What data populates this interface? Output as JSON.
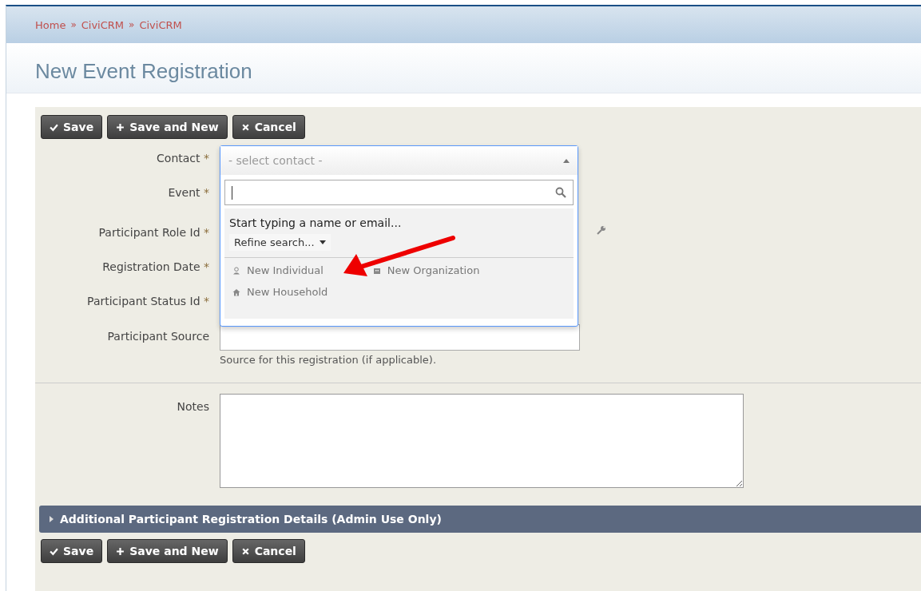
{
  "breadcrumb": [
    "Home",
    "CiviCRM",
    "CiviCRM"
  ],
  "breadcrumb_separator": "»",
  "title": "New Event Registration",
  "buttons": [
    {
      "kind": "save",
      "label": "Save"
    },
    {
      "kind": "new",
      "label": "Save and New"
    },
    {
      "kind": "cancel",
      "label": "Cancel"
    }
  ],
  "fields": [
    {
      "label": "Contact",
      "required_mark": "*"
    },
    {
      "label": "Event",
      "required_mark": "*"
    },
    {
      "label": "Participant Role Id",
      "required_mark": "*"
    },
    {
      "label": "Registration Date",
      "required_mark": "*"
    },
    {
      "label": "Participant Status Id",
      "required_mark": "*"
    },
    {
      "label": "Participant Source",
      "help": "Source for this registration (if applicable)."
    }
  ],
  "contact_dropdown": {
    "placeholder": "- select contact -",
    "expanded": true,
    "hint": "Start typing a name or email...",
    "refine": "Refine search...",
    "new_links": [
      {
        "kind": "individual",
        "label": "New Individual"
      },
      {
        "kind": "organization",
        "label": "New Organization"
      },
      {
        "kind": "household",
        "label": "New Household"
      }
    ]
  },
  "notes": {
    "label": "Notes"
  },
  "section": {
    "label": "Additional Participant Registration Details (Admin Use Only)",
    "expanded": false
  },
  "bottom_buttons": [
    {
      "kind": "save",
      "label": "Save"
    },
    {
      "kind": "new",
      "label": "Save and New"
    },
    {
      "kind": "cancel",
      "label": "Cancel"
    }
  ]
}
